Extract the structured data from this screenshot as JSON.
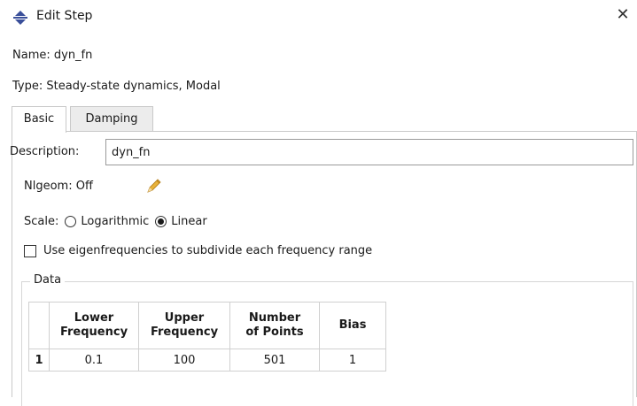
{
  "window": {
    "title": "Edit Step",
    "close_glyph": "✕"
  },
  "name": {
    "label": "Name:",
    "value": "dyn_fn"
  },
  "type": {
    "label": "Type:",
    "value": "Steady-state dynamics, Modal"
  },
  "tabs": [
    {
      "label": "Basic"
    },
    {
      "label": "Damping"
    }
  ],
  "description": {
    "label": "Description:",
    "value": "dyn_fn"
  },
  "nlgeom": {
    "label": "Nlgeom:",
    "value": "Off"
  },
  "scale": {
    "label": "Scale:",
    "options": [
      {
        "label": "Logarithmic",
        "selected": false
      },
      {
        "label": "Linear",
        "selected": true
      }
    ]
  },
  "eigen_checkbox": {
    "label": "Use eigenfrequencies to subdivide each frequency range",
    "checked": false
  },
  "data_group": {
    "label": "Data",
    "columns": [
      {
        "line1": "Lower",
        "line2": "Frequency"
      },
      {
        "line1": "Upper",
        "line2": "Frequency"
      },
      {
        "line1": "Number",
        "line2": "of Points"
      },
      {
        "line1": "Bias",
        "line2": ""
      }
    ],
    "rows": [
      {
        "index": "1",
        "cells": [
          "0.1",
          "100",
          "501",
          "1"
        ]
      }
    ]
  },
  "icons": {
    "app": "abaqus-step-icon",
    "nlgeom": "pencil-icon"
  },
  "colors": {
    "icon_blue": "#3a4f9a",
    "pencil_yellow": "#e8b23a"
  }
}
